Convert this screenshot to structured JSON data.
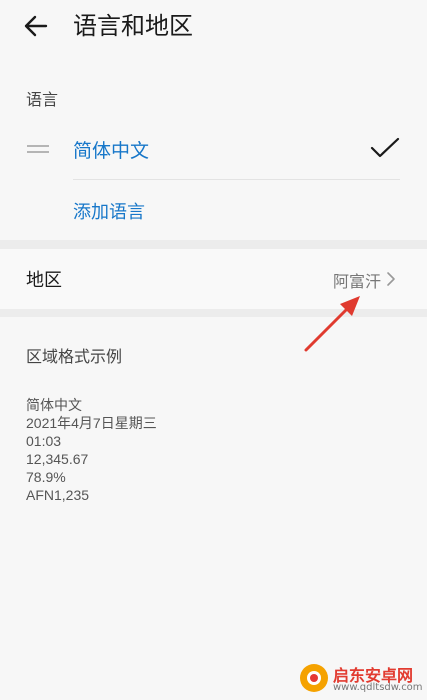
{
  "header": {
    "title": "语言和地区",
    "back_icon": "back-arrow-icon"
  },
  "language_section": {
    "label": "语言",
    "languages": [
      {
        "name": "简体中文",
        "selected": true
      }
    ],
    "add_label": "添加语言"
  },
  "region": {
    "label": "地区",
    "value": "阿富汗",
    "chevron_icon": "chevron-right-icon"
  },
  "format_sample": {
    "title": "区域格式示例",
    "lines": [
      "简体中文",
      "2021年4月7日星期三",
      "01:03",
      "12,345.67",
      "78.9%",
      "AFN1,235"
    ]
  },
  "watermark": {
    "name": "启东安卓网",
    "url": "www.qdltsdw.com"
  },
  "colors": {
    "accent": "#1777c9",
    "background": "#f7f7f7",
    "band": "#ececec",
    "annotation_arrow": "#e03a2f"
  }
}
